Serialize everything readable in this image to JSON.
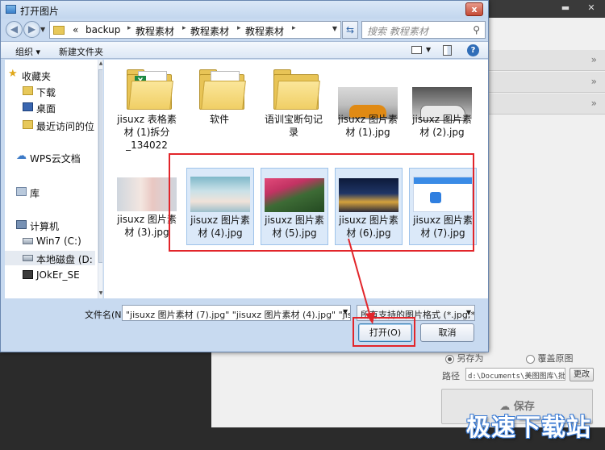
{
  "dialog": {
    "title": "打开图片",
    "close_label": "x",
    "address": [
      "«",
      "backup",
      "教程素材",
      "教程素材",
      "教程素材"
    ],
    "search_placeholder": "搜索 教程素材",
    "toolbar": {
      "organize": "组织 ▾",
      "new_folder": "新建文件夹"
    },
    "nav": [
      {
        "label": "收藏夹",
        "icon": "star-icon"
      },
      {
        "label": "下载",
        "icon": "download-folder-icon"
      },
      {
        "label": "桌面",
        "icon": "desktop-icon"
      },
      {
        "label": "最近访问的位",
        "icon": "recent-places-icon"
      },
      {
        "label": "WPS云文档",
        "icon": "cloud-icon"
      },
      {
        "label": "库",
        "icon": "library-icon"
      },
      {
        "label": "计算机",
        "icon": "computer-icon"
      },
      {
        "label": "Win7 (C:)",
        "icon": "drive-icon"
      },
      {
        "label": "本地磁盘 (D:",
        "icon": "drive-icon"
      },
      {
        "label": "JOkEr_SE",
        "icon": "network-drive-icon"
      }
    ],
    "files": [
      {
        "name": "jisuxz 表格素材 (1)拆分_134022",
        "type": "excel-folder"
      },
      {
        "name": "软件",
        "type": "folder"
      },
      {
        "name": "语训宝断句记录",
        "type": "folder"
      },
      {
        "name": "jisuxz 图片素材 (1).jpg",
        "type": "car-orange"
      },
      {
        "name": "jisuxz 图片素材 (2).jpg",
        "type": "car-white"
      },
      {
        "name": "jisuxz 图片素材 (3).jpg",
        "type": "girl-1"
      },
      {
        "name": "jisuxz 图片素材 (4).jpg",
        "type": "girl-2"
      },
      {
        "name": "jisuxz 图片素材 (5).jpg",
        "type": "flowers"
      },
      {
        "name": "jisuxz 图片素材 (6).jpg",
        "type": "night-city"
      },
      {
        "name": "jisuxz 图片素材 (7).jpg",
        "type": "app-screen"
      }
    ],
    "filename_label": "文件名(N):",
    "filename_value": "\"jisuxz 图片素材 (7).jpg\" \"jisuxz 图片素材 (4).jpg\" \"jisuxz 图片素",
    "filter_value": "所有支持的图片格式 (*.jpg;*.jp",
    "open_label": "打开(O)",
    "cancel_label": "取消"
  },
  "background_app": {
    "save_as": "另存为",
    "overwrite": "覆盖原图",
    "path_label": "路径",
    "path_value": "d:\\Documents\\美图图库\\批处",
    "change_label": "更改",
    "save_label": "保存"
  },
  "watermark": "极速下载站",
  "colors": {
    "annotation_red": "#e2252a",
    "dialog_frame": "#c8daf0",
    "selection": "#dbe9f9"
  }
}
